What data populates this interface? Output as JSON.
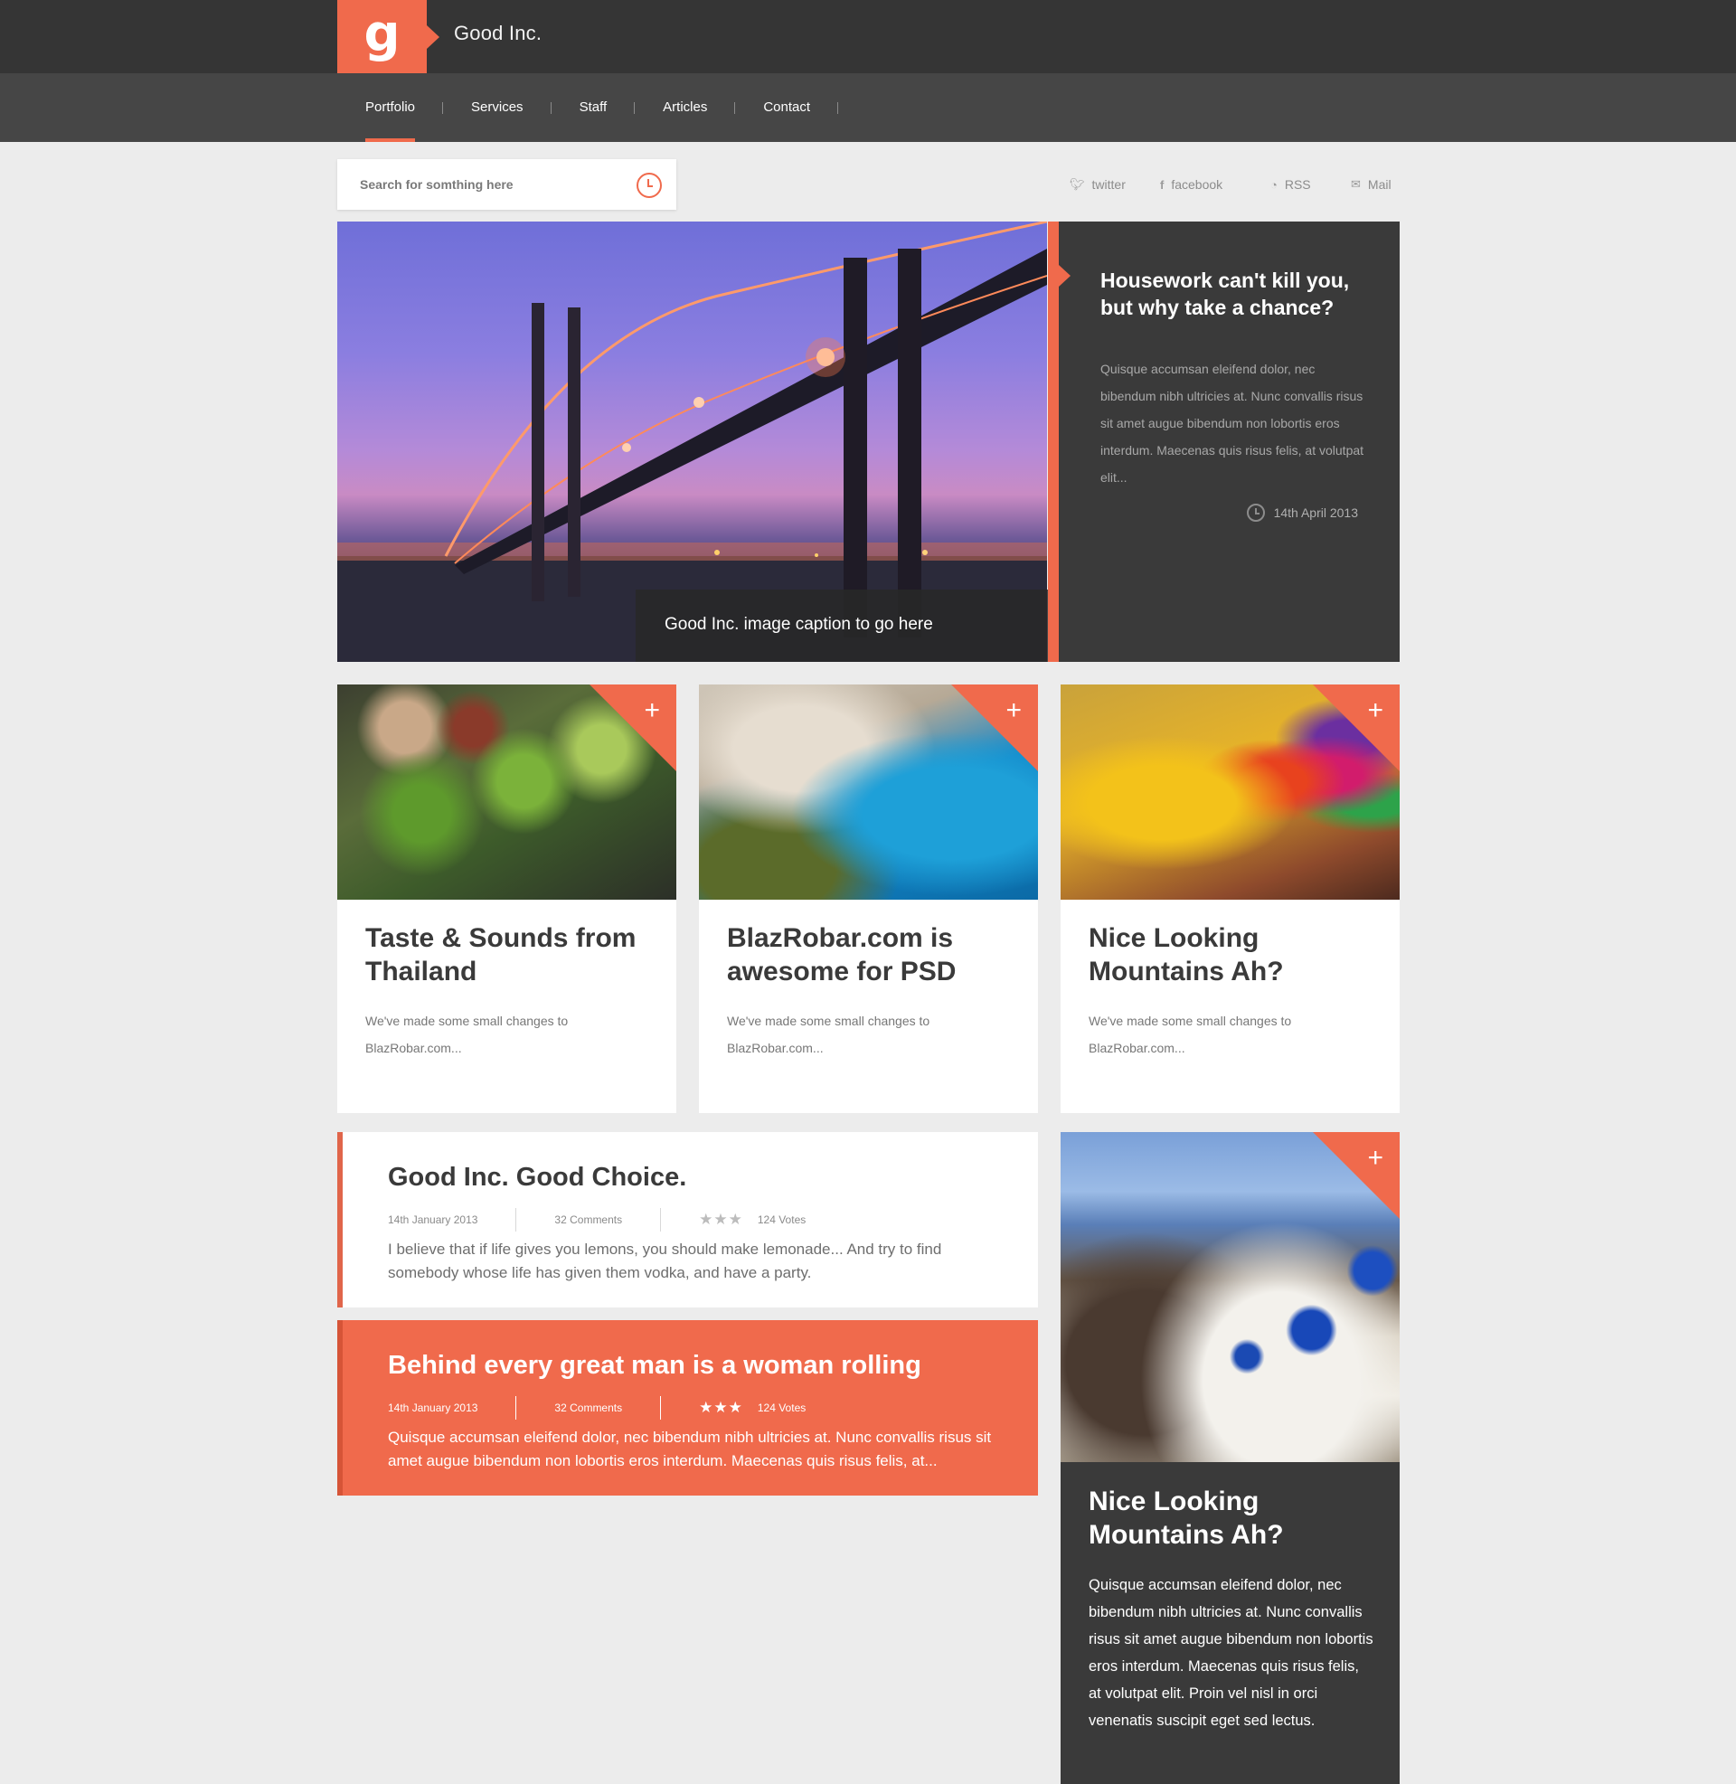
{
  "header": {
    "logo_letter": "g",
    "brand": "Good Inc."
  },
  "nav": {
    "items": [
      {
        "label": "Portfolio",
        "active": true
      },
      {
        "label": "Services",
        "active": false
      },
      {
        "label": "Staff",
        "active": false
      },
      {
        "label": "Articles",
        "active": false
      },
      {
        "label": "Contact",
        "active": false
      }
    ]
  },
  "search": {
    "placeholder": "Search for somthing here"
  },
  "social": {
    "twitter": "twitter",
    "facebook": "facebook",
    "rss": "RSS",
    "mail": "Mail"
  },
  "hero": {
    "caption": "Good Inc. image caption to go here",
    "title": "Housework can't kill you, but why take a chance?",
    "text": "Quisque accumsan eleifend dolor, nec bibendum nibh ultricies at. Nunc convallis risus sit amet augue bibendum non lobortis eros interdum. Maecenas quis risus felis, at volutpat elit...",
    "date": "14th April 2013"
  },
  "cards": [
    {
      "title": "Taste & Sounds from Thailand",
      "text": "We've made some small changes to BlazRobar.com...",
      "plus": "+"
    },
    {
      "title": "BlazRobar.com is awesome for PSD",
      "text": "We've made some small changes to BlazRobar.com...",
      "plus": "+"
    },
    {
      "title": "Nice Looking Mountains Ah?",
      "text": "We've made some small changes to BlazRobar.com...",
      "plus": "+"
    }
  ],
  "quotes": [
    {
      "title": "Good Inc. Good Choice.",
      "date": "14th January 2013",
      "comments": "32 Comments",
      "stars": "★★★",
      "votes": "124 Votes",
      "text": "I believe that if life gives you lemons, you should make lemonade... And try to find somebody whose life has given them vodka, and have a party."
    },
    {
      "title": "Behind every great man is a woman rolling",
      "date": "14th January 2013",
      "comments": "32 Comments",
      "stars": "★★★",
      "votes": "124 Votes",
      "text": "Quisque accumsan eleifend dolor, nec bibendum nibh ultricies at. Nunc convallis risus sit amet augue bibendum non lobortis eros interdum. Maecenas quis risus felis, at..."
    }
  ],
  "tall_card": {
    "title": "Nice Looking Mountains Ah?",
    "text": "Quisque accumsan eleifend dolor, nec bibendum nibh ultricies at. Nunc convallis risus sit amet augue bibendum non lobortis eros interdum. Maecenas quis risus felis, at volutpat elit. Proin vel nisl in orci venenatis suscipit eget sed lectus.",
    "plus": "+"
  },
  "colors": {
    "accent": "#f06a4c",
    "dark": "#353535",
    "nav": "#464646",
    "panel": "#3a3a3a",
    "background": "#ececec"
  }
}
